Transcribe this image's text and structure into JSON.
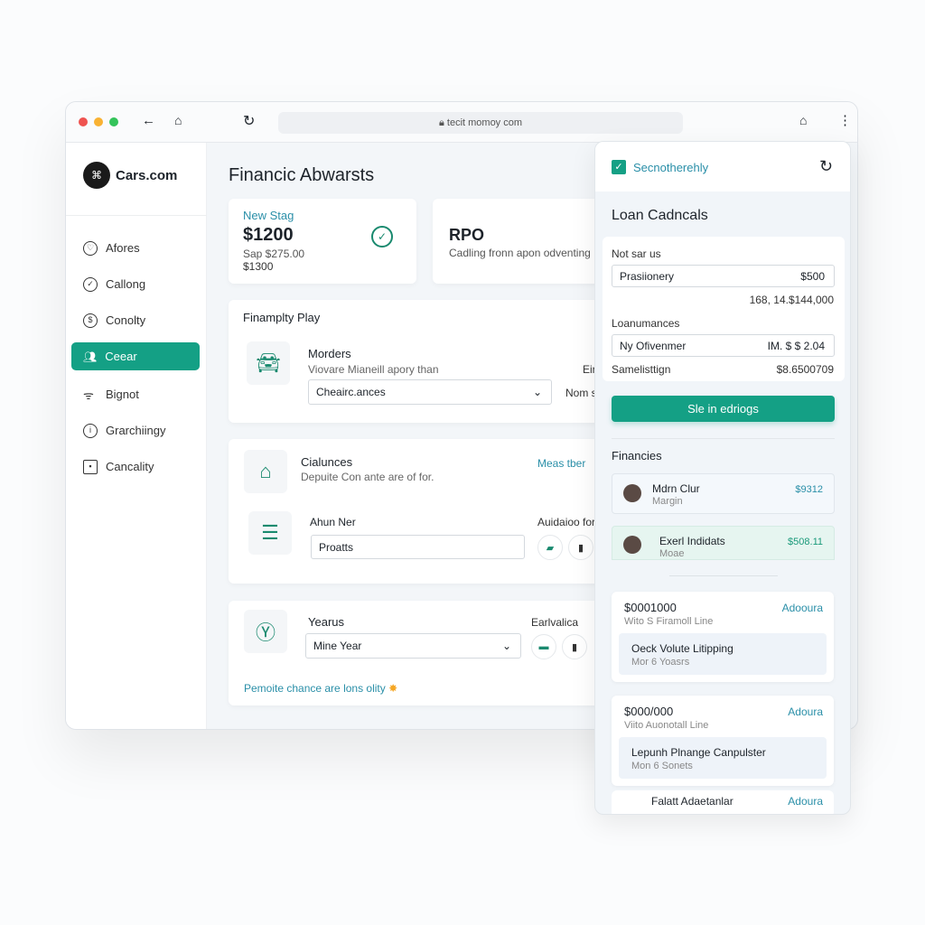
{
  "browser": {
    "url": "tecit momoy com"
  },
  "sidebar": {
    "brand": "Cars.com",
    "items": [
      {
        "label": "Afores",
        "icon": "heart-icon"
      },
      {
        "label": "Callong",
        "icon": "check-circle-icon"
      },
      {
        "label": "Conolty",
        "icon": "dollar-circle-icon"
      },
      {
        "label": "Ceear",
        "icon": "people-icon",
        "active": true
      },
      {
        "label": "Bignot",
        "icon": "wifi-icon"
      },
      {
        "label": "Grarchiingy",
        "icon": "info-icon"
      },
      {
        "label": "Cancality",
        "icon": "id-card-icon"
      }
    ]
  },
  "main": {
    "title": "Financic Abwarsts",
    "stat1": {
      "label": "New Stag",
      "value": "$1200",
      "sub1": "Sap $275.00",
      "sub2": "$1300"
    },
    "stat2": {
      "title": "RPO",
      "desc": "Cadling fronn apon odventing"
    },
    "section1": {
      "title": "Finamplty Play",
      "item_title": "Morders",
      "item_desc": "Viovare Mianeill apory than",
      "select": "Cheairc.ances",
      "side1": "Eir",
      "side2": "Nom s"
    },
    "section2": {
      "title": "Cialunces",
      "desc": "Depuite Con ante are of for.",
      "link": "Meas tber",
      "field_label": "Ahun Ner",
      "field_value": "Proatts",
      "side": "Auidaioo for"
    },
    "section3": {
      "title": "Yearus",
      "select": "Mine Year",
      "side": "Earlvalica",
      "footer": "Pemoite chance are lons olity"
    }
  },
  "panel": {
    "checkbox_label": "Secnotherehly",
    "checked": true,
    "title": "Loan Cadncals",
    "group1_label": "Not sar us",
    "field1_label": "Prasiionery",
    "field1_value": "$500",
    "total": "168, 14.$144,000",
    "group2_label": "Loanumances",
    "field2_label": "Ny Ofivenmer",
    "field2_value": "IM. $ $ 2.04",
    "row_label": "Samelisttign",
    "row_value": "$8.6500709",
    "button": "Sle in edriogs",
    "fin_title": "Financies",
    "people": [
      {
        "name": "Mdrn Clur",
        "sub": "Margin",
        "amount": "$9312"
      },
      {
        "name": "Exerl Indidats",
        "sub": "Moae",
        "amount": "$508.11"
      }
    ],
    "offers": [
      {
        "amount": "$0001000",
        "sub": "Wito S Firamoll Line",
        "link": "Adooura",
        "inner_title": "Oeck Volute Litipping",
        "inner_sub": "Mor 6 Yoasrs"
      },
      {
        "amount": "$000/000",
        "sub": "Viito Auonotall Line",
        "link": "Adoura",
        "inner_title": "Lepunh Plnange Canpulster",
        "inner_sub": "Mon 6 Sonets"
      },
      {
        "amount": "",
        "sub": "",
        "link": "Adoura",
        "inner_title": "Falatt Adaetanlar",
        "inner_sub": ""
      }
    ]
  },
  "colors": {
    "accent": "#14a085",
    "link": "#2a8fa8"
  }
}
